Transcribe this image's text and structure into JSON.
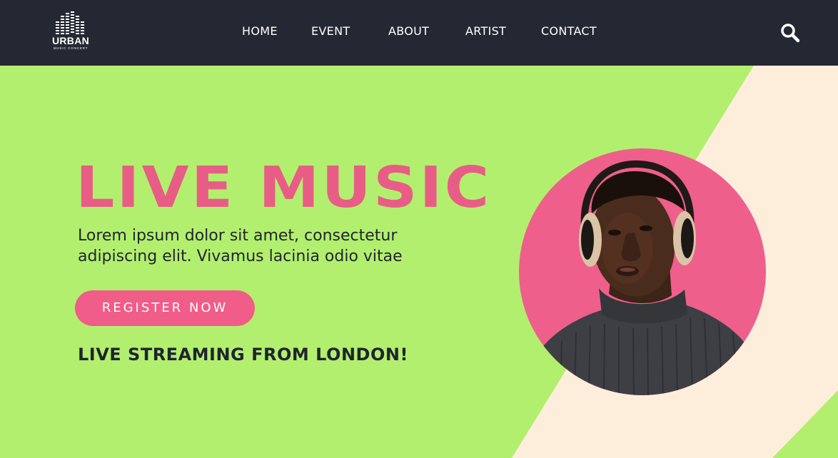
{
  "brand": {
    "name": "URBAN",
    "tagline": "MUSIC CONCERT"
  },
  "nav": {
    "items": [
      "HOME",
      "EVENT",
      "ABOUT",
      "ARTIST",
      "CONTACT"
    ],
    "search_icon": "search-icon"
  },
  "hero": {
    "headline": "LIVE MUSIC",
    "lead": "Lorem ipsum dolor sit amet, consectetur adipiscing elit. Vivamus lacinia odio vitae",
    "cta_label": "REGISTER NOW",
    "streaming_text": "LIVE STREAMING FROM LONDON!",
    "portrait_icon": "man-with-headphones-photo"
  },
  "colors": {
    "nav_bg": "#242833",
    "hero_bg": "#b3ef6e",
    "stripe": "#fdeedc",
    "accent_pink": "#ef5d88",
    "text_dark": "#1f2430"
  }
}
